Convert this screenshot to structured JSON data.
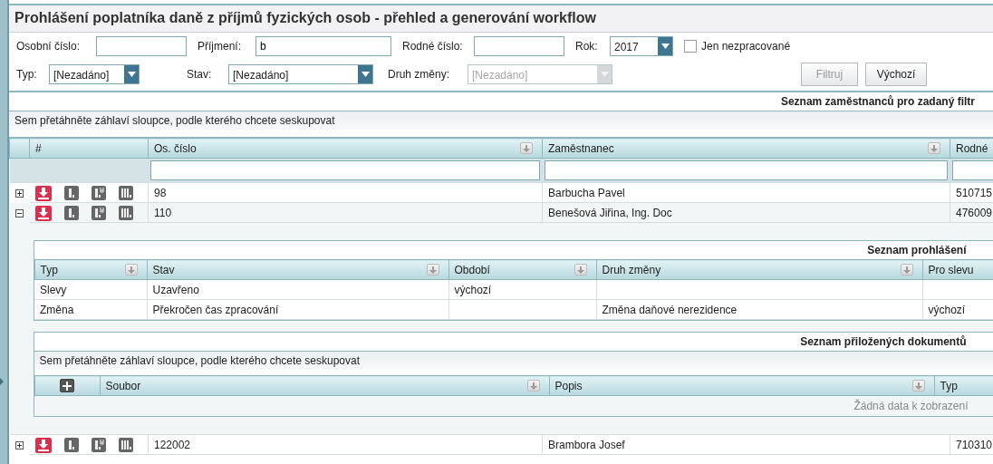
{
  "title": "Prohlášení poplatníka daně z příjmů fyzických osob - přehled a generování workflow",
  "filter_rows": [
    {
      "fields": [
        {
          "kind": "text",
          "label": "Osobní číslo:"
        },
        {
          "kind": "text",
          "label": "Příjmení:",
          "value": "b"
        },
        {
          "kind": "text",
          "label": "Rodné číslo:"
        },
        {
          "kind": "select",
          "label": "Rok:",
          "value": "2017",
          "disabled": false
        },
        {
          "kind": "checkbox",
          "label": "Jen nezpracované",
          "checked": false
        }
      ]
    },
    {
      "fields": [
        {
          "kind": "select",
          "label": "Typ:",
          "value": "[Nezadáno]",
          "disabled": false
        },
        {
          "kind": "select",
          "label": "Stav:",
          "value": "[Nezadáno]",
          "disabled": false
        },
        {
          "kind": "select",
          "label": "Druh změny:",
          "value": "[Nezadáno]",
          "disabled": true
        }
      ]
    }
  ],
  "buttons": [
    {
      "label": "Filtruj",
      "disabled": true
    },
    {
      "label": "Výchozí",
      "disabled": false
    }
  ],
  "grid": {
    "caption": "Seznam zaměstnanců pro zadaný filtr",
    "group_hint": "Sem přetáhněte záhlaví sloupce, podle kterého chcete seskupovat",
    "action_header": "#",
    "columns": [
      "Os. číslo",
      "Zaměstnanec",
      "Rodné"
    ],
    "rows": [
      {
        "expanded": false,
        "cells": [
          "98",
          "Barbucha Pavel",
          "510715"
        ]
      },
      {
        "expanded": true,
        "cells": [
          "110",
          "Benešová Jiřina, Ing. Doc",
          "476009"
        ],
        "detail": {
          "declarations": {
            "caption": "Seznam prohlášení",
            "columns": [
              "Typ",
              "Stav",
              "Období",
              "Druh změny",
              "Pro slevu"
            ],
            "rows": [
              [
                "Slevy",
                "Uzavřeno",
                "výchozí",
                "",
                ""
              ],
              [
                "Změna",
                "Překročen čas zpracování",
                "",
                "Změna daňové nerezidence",
                "výchozí"
              ]
            ]
          },
          "documents": {
            "caption": "Seznam přiložených dokumentů",
            "group_hint": "Sem přetáhněte záhlaví sloupce, podle kterého chcete seskupovat",
            "columns": [
              "Soubor",
              "Popis",
              "Typ"
            ],
            "empty_text": "Žádná data k zobrazení"
          }
        }
      },
      {
        "expanded": false,
        "cells": [
          "122002",
          "Brambora Josef",
          "710310"
        ]
      }
    ]
  }
}
